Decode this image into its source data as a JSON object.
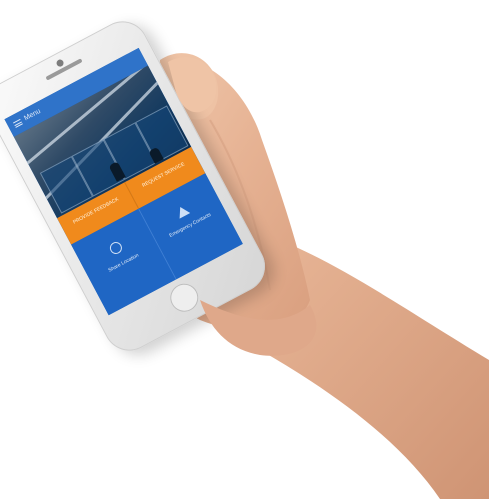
{
  "app": {
    "header_title": "Menu"
  },
  "tiles": {
    "orange": [
      {
        "label": "PROVIDE FEEDBACK"
      },
      {
        "label": "REQUEST SERVICE"
      }
    ],
    "blue": [
      {
        "label": "Share Location",
        "icon": "location-icon"
      },
      {
        "label": "Emergency Contacts",
        "icon": "alert-icon"
      }
    ]
  },
  "colors": {
    "header_blue": "#2f73c9",
    "tile_orange": "#f08a1c",
    "tile_blue": "#1f66c4",
    "skin": "#e8b99a"
  }
}
